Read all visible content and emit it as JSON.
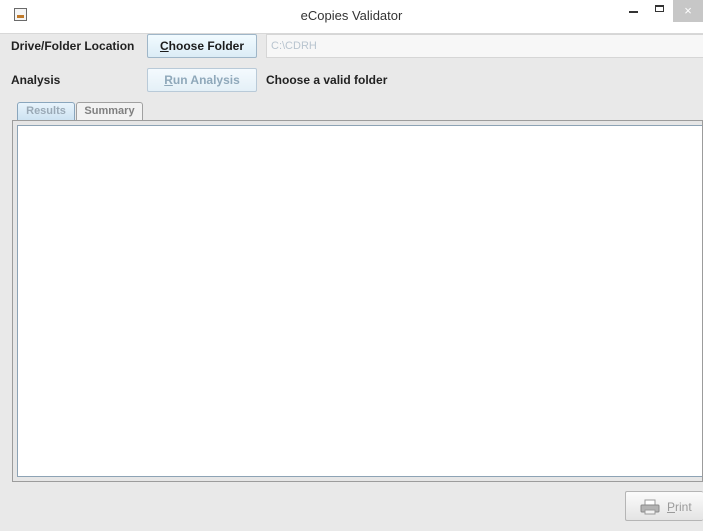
{
  "window": {
    "title": "eCopies Validator",
    "close_glyph": "×"
  },
  "rows": {
    "location_label": "Drive/Folder Location",
    "choose_folder_button": "Choose Folder",
    "path_value": "C:\\CDRH",
    "analysis_label": "Analysis",
    "run_analysis_button": "Run Analysis",
    "status_text": "Choose a valid folder"
  },
  "tabs": [
    {
      "label": "Results",
      "active": true
    },
    {
      "label": "Summary",
      "active": false
    }
  ],
  "footer": {
    "print_button": "Print"
  }
}
